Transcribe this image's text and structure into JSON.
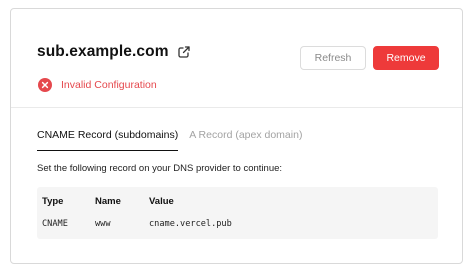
{
  "domain": {
    "name": "sub.example.com",
    "link_icon": "external-link-icon"
  },
  "status": {
    "icon": "error-circle-icon",
    "text": "Invalid Configuration",
    "color": "#e5484d"
  },
  "actions": {
    "refresh_label": "Refresh",
    "remove_label": "Remove",
    "remove_color": "#ee3a3a"
  },
  "tabs": [
    {
      "label": "CNAME Record (subdomains)",
      "active": true
    },
    {
      "label": "A Record (apex domain)",
      "active": false
    }
  ],
  "instructions": "Set the following record on your DNS provider to continue:",
  "record": {
    "headers": {
      "type": "Type",
      "name": "Name",
      "value": "Value"
    },
    "row": {
      "type": "CNAME",
      "name": "www",
      "value": "cname.vercel.pub"
    }
  }
}
